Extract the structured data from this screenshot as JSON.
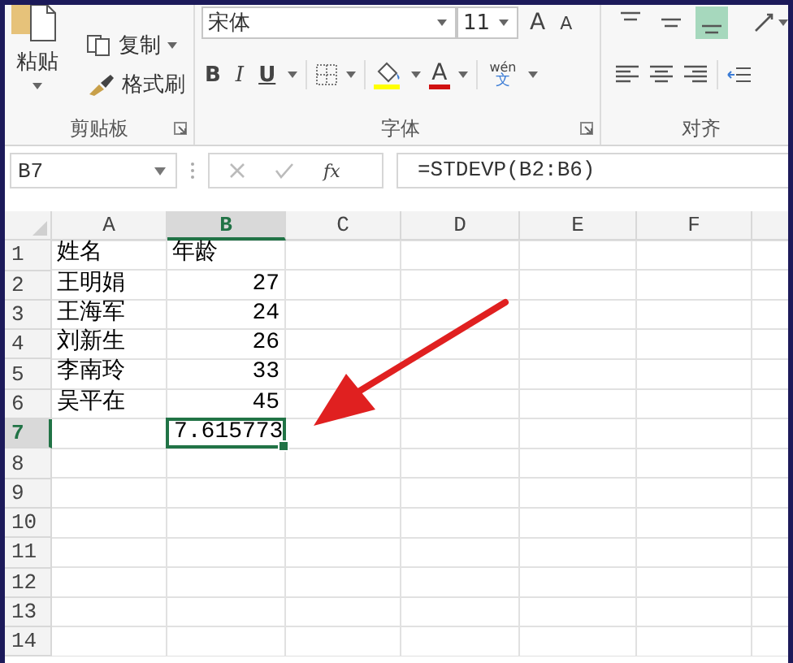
{
  "ribbon": {
    "clipboard": {
      "paste": "粘贴",
      "copy": "复制",
      "format_painter": "格式刷",
      "label": "剪贴板"
    },
    "font": {
      "font_name": "宋体",
      "font_size": "11",
      "grow": "A",
      "shrink": "A",
      "bold": "B",
      "italic": "I",
      "underline": "U",
      "font_color": "A",
      "phonetic_top": "wén",
      "phonetic_bottom": "文",
      "label": "字体"
    },
    "alignment": {
      "vertical_align": [
        {
          "selected": false
        },
        {
          "selected": false
        },
        {
          "selected": true
        }
      ],
      "label": "对齐"
    }
  },
  "formula_bar": {
    "name_box": "B7",
    "function_button": "fx",
    "formula": "=STDEVP(B2:B6)"
  },
  "columns": [
    {
      "label": "A",
      "selected": false
    },
    {
      "label": "B",
      "selected": true
    },
    {
      "label": "C",
      "selected": false
    },
    {
      "label": "D",
      "selected": false
    },
    {
      "label": "E",
      "selected": false
    },
    {
      "label": "F",
      "selected": false
    }
  ],
  "rows": [
    {
      "number": "1",
      "selected": false,
      "cells": [
        {
          "text": "姓名",
          "kind": "text"
        },
        {
          "text": "年龄",
          "kind": "text"
        }
      ]
    },
    {
      "number": "2",
      "selected": false,
      "cells": [
        {
          "text": "王明娟",
          "kind": "text"
        },
        {
          "text": "27",
          "kind": "number"
        }
      ]
    },
    {
      "number": "3",
      "selected": false,
      "cells": [
        {
          "text": "王海军",
          "kind": "text"
        },
        {
          "text": "24",
          "kind": "number"
        }
      ]
    },
    {
      "number": "4",
      "selected": false,
      "cells": [
        {
          "text": "刘新生",
          "kind": "text"
        },
        {
          "text": "26",
          "kind": "number"
        }
      ]
    },
    {
      "number": "5",
      "selected": false,
      "cells": [
        {
          "text": "李南玲",
          "kind": "text"
        },
        {
          "text": "33",
          "kind": "number"
        }
      ]
    },
    {
      "number": "6",
      "selected": false,
      "cells": [
        {
          "text": "吴平在",
          "kind": "text"
        },
        {
          "text": "45",
          "kind": "number"
        }
      ]
    },
    {
      "number": "7",
      "selected": true,
      "cells": [
        null,
        {
          "text": "7.615773",
          "kind": "number"
        }
      ]
    },
    {
      "number": "8",
      "selected": false,
      "cells": []
    },
    {
      "number": "9",
      "selected": false,
      "cells": []
    },
    {
      "number": "10",
      "selected": false,
      "cells": []
    },
    {
      "number": "11",
      "selected": false,
      "cells": []
    },
    {
      "number": "12",
      "selected": false,
      "cells": []
    },
    {
      "number": "13",
      "selected": false,
      "cells": []
    },
    {
      "number": "14",
      "selected": false,
      "cells": []
    }
  ]
}
